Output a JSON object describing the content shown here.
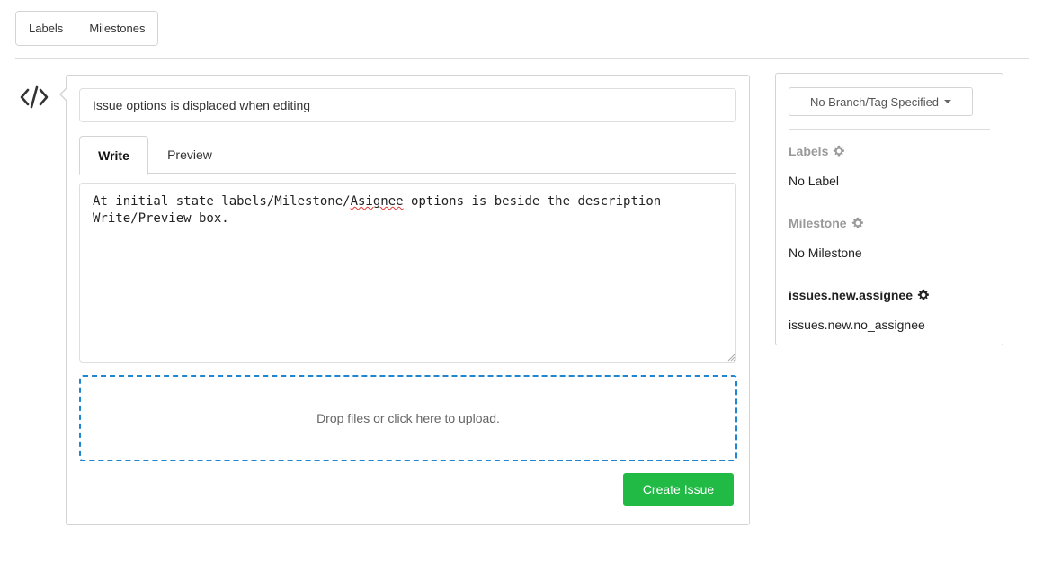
{
  "nav": {
    "labels_button": "Labels",
    "milestones_button": "Milestones"
  },
  "issue_form": {
    "title_value": "Issue options is displaced when editing",
    "tabs": {
      "write": "Write",
      "preview": "Preview"
    },
    "content_parts": {
      "before": "At initial state labels/Milestone/",
      "misspelled": "Asignee",
      "after": " options is beside the description\nWrite/Preview box."
    },
    "dropzone_text": "Drop files or click here to upload.",
    "create_button": "Create Issue"
  },
  "sidebar": {
    "branch_button": "No Branch/Tag Specified",
    "labels_heading": "Labels",
    "labels_value": "No Label",
    "milestone_heading": "Milestone",
    "milestone_value": "No Milestone",
    "assignee_heading": "issues.new.assignee",
    "assignee_value": "issues.new.no_assignee"
  },
  "icons": {
    "avatar": "code-icon",
    "settings": "gear-icon",
    "dropdown": "caret-down-icon"
  },
  "colors": {
    "primary_button": "#21ba45",
    "dropzone_border": "#2185d0",
    "muted_heading": "#999999"
  }
}
